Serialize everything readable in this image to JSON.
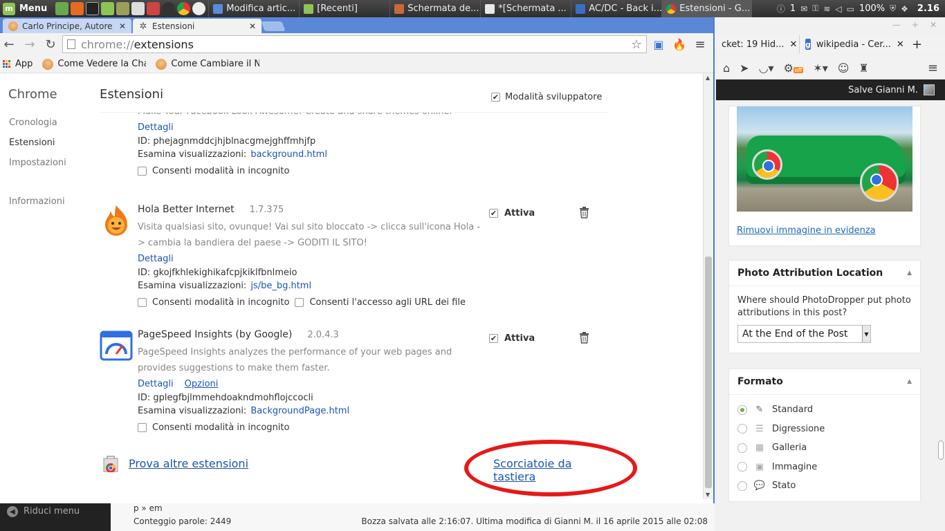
{
  "taskbar": {
    "menu_label": "Menu",
    "windows": [
      {
        "label": "Modifica artic...",
        "color": "#5b8cd9",
        "active": false
      },
      {
        "label": "[Recenti]",
        "color": "#8fc356",
        "active": false
      },
      {
        "label": "Schermata de...",
        "color": "#c76a3a",
        "active": false
      },
      {
        "label": "*[Schermata ...",
        "color": "#e8e8e8",
        "active": false
      },
      {
        "label": "AC/DC - Back i...",
        "color": "#3a6fc7",
        "active": false
      },
      {
        "label": "Estensioni - G...",
        "color": "#f2b233",
        "active": true
      }
    ],
    "tray": {
      "count": "1",
      "battery": "100%",
      "clock": "2.16"
    }
  },
  "browser": {
    "tabs": [
      {
        "label": "Carlo Principe, Autore ...",
        "active": false
      },
      {
        "label": "Estensioni",
        "active": true
      }
    ],
    "url_scheme": "chrome://",
    "url_host": "extensions",
    "bookmarks": [
      {
        "label": "App"
      },
      {
        "label": "Come Vedere la Cha"
      },
      {
        "label": "Come Cambiare il N"
      }
    ]
  },
  "sidebar": {
    "title": "Chrome",
    "items": [
      {
        "label": "Cronologia"
      },
      {
        "label": "Estensioni"
      },
      {
        "label": "Impostazioni"
      },
      {
        "label": "Informazioni"
      }
    ]
  },
  "page": {
    "title": "Estensioni",
    "dev_mode_label": "Modalità sviluppatore"
  },
  "extensions": [
    {
      "description": "Make Your Facebook Look Awesome! Create and share themes online.",
      "details_label": "Dettagli",
      "id_line": "ID: phejagnmddcjhjblnacgmejghffmhjfp",
      "inspect_label": "Esamina visualizzazioni:",
      "inspect_link": "background.html",
      "incognito_label": "Consenti modalità in incognito"
    },
    {
      "name": "Hola Better Internet",
      "version": "1.7.375",
      "description": "Visita qualsiasi sito, ovunque! Vai sul sito bloccato -> clicca sull'icona Hola -> cambia la bandiera del paese -> GODITI IL SITO!",
      "details_label": "Dettagli",
      "id_line": "ID: gkojfkhlekighikafcpjkiklfbnlmeio",
      "inspect_label": "Esamina visualizzazioni:",
      "inspect_link": "js/be_bg.html",
      "incognito_label": "Consenti modalità in incognito",
      "file_access_label": "Consenti l'accesso agli URL dei file",
      "active_label": "Attiva"
    },
    {
      "name": "PageSpeed Insights (by Google)",
      "version": "2.0.4.3",
      "description": "PageSpeed Insights analyzes the performance of your web pages and provides suggestions to make them faster.",
      "details_label": "Dettagli",
      "options_label": "Opzioni",
      "id_line": "ID: gplegfbjlmmehdoakndmohflojccocli",
      "inspect_label": "Esamina visualizzazioni:",
      "inspect_link": "BackgroundPage.html",
      "incognito_label": "Consenti modalità in incognito",
      "active_label": "Attiva"
    }
  ],
  "footer": {
    "more_extensions": "Prova altre estensioni",
    "shortcuts": "Scorciatoie da tastiera"
  },
  "wp": {
    "collapse_menu": "Riduci menu",
    "path": "p » em",
    "word_count": "Conteggio parole: 2449",
    "saved": "Bozza salvata alle 2:16:07. Ultima modifica di Gianni M. il 16 aprile 2015 alle 02:08"
  },
  "right": {
    "tabs": [
      {
        "label": "cket: 19 Hid..."
      },
      {
        "label": "wikipedia - Cer..."
      }
    ],
    "greeting": "Salve Gianni M.",
    "featured_remove": "Rimuovi immagine in evidenza",
    "photo_box": {
      "title": "Photo Attribution Location",
      "question": "Where should PhotoDropper put photo attributions in this post?",
      "selected": "At the End of the Post"
    },
    "format_box": {
      "title": "Formato",
      "options": [
        {
          "label": "Standard",
          "selected": true
        },
        {
          "label": "Digressione",
          "selected": false
        },
        {
          "label": "Galleria",
          "selected": false
        },
        {
          "label": "Immagine",
          "selected": false
        },
        {
          "label": "Stato",
          "selected": false
        }
      ]
    }
  }
}
